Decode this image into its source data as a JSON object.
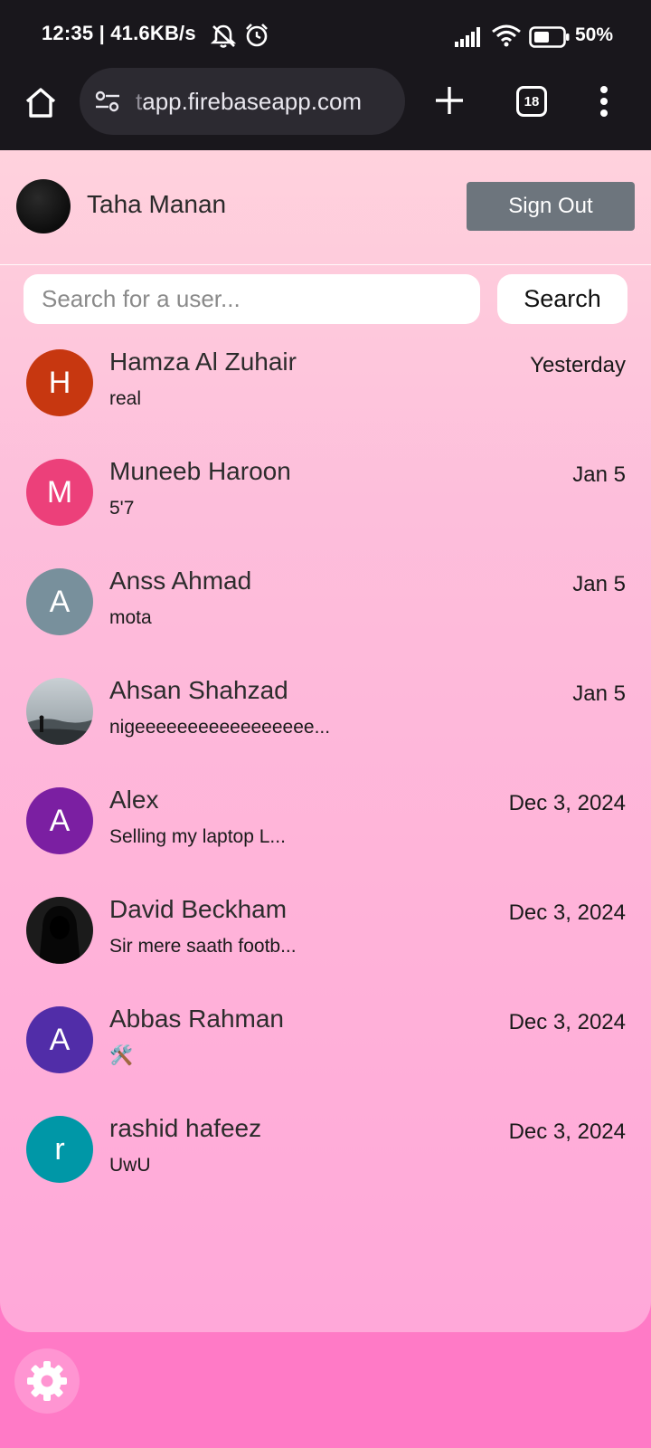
{
  "status_bar": {
    "time": "12:35 | 41.6KB/s",
    "battery": "50%",
    "icons": [
      "bell-off-icon",
      "alarm-icon",
      "signal-icon",
      "wifi-icon",
      "battery-icon"
    ]
  },
  "browser": {
    "url_faded": "t",
    "url_main": "app.firebaseapp.com",
    "tab_count": "18",
    "icons": [
      "home-icon",
      "page-info-icon",
      "new-tab-icon",
      "tab-switcher-icon",
      "more-menu-icon"
    ]
  },
  "header": {
    "user_name": "Taha Manan",
    "sign_out_label": "Sign Out"
  },
  "search": {
    "placeholder": "Search for a user...",
    "button_label": "Search"
  },
  "chats": [
    {
      "initial": "H",
      "name": "Hamza Al Zuhair",
      "message": "real",
      "time": "Yesterday",
      "avatar_color": "#c73710"
    },
    {
      "initial": "M",
      "name": "Muneeb Haroon",
      "message": "5'7",
      "time": "Jan 5",
      "avatar_color": "#ec407a"
    },
    {
      "initial": "A",
      "name": "Anss Ahmad",
      "message": "mota",
      "time": "Jan 5",
      "avatar_color": "#78909c"
    },
    {
      "initial": "",
      "name": "Ahsan Shahzad",
      "message": "nigeeeeeeeeeeeeeeeee...",
      "time": "Jan 5",
      "avatar_color": "#9ea7ad"
    },
    {
      "initial": "A",
      "name": "Alex",
      "message": "Selling my laptop L...",
      "time": "Dec 3, 2024",
      "avatar_color": "#7b1fa2"
    },
    {
      "initial": "",
      "name": "David Beckham",
      "message": "Sir mere saath footb...",
      "time": "Dec 3, 2024",
      "avatar_color": "#1a1a1a"
    },
    {
      "initial": "A",
      "name": "Abbas Rahman",
      "message": "🛠️",
      "time": "Dec 3, 2024",
      "avatar_color": "#512da8"
    },
    {
      "initial": "r",
      "name": "rashid hafeez",
      "message": "UwU",
      "time": "Dec 3, 2024",
      "avatar_color": "#0097a7"
    }
  ],
  "footer": {
    "settings_icon": "gear-icon"
  }
}
